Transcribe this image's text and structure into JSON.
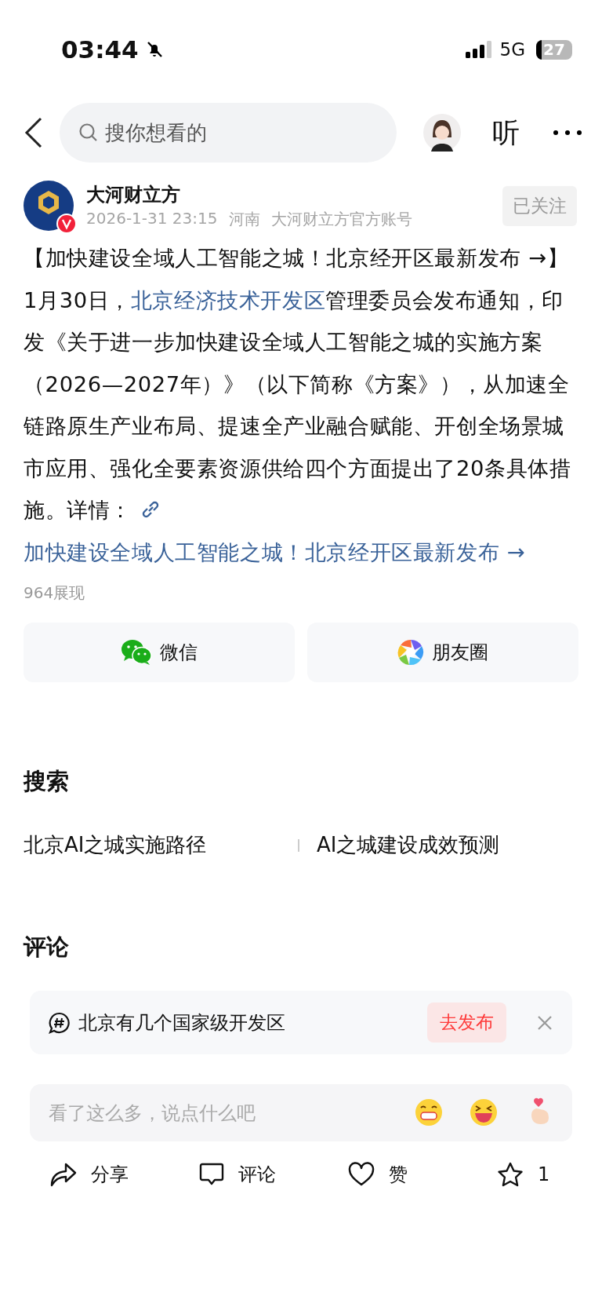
{
  "status_bar": {
    "time": "03:44",
    "silent": true,
    "network": "5G",
    "battery": "27"
  },
  "nav": {
    "search_placeholder": "搜你想看的",
    "listen": "听"
  },
  "author": {
    "name": "大河财立方",
    "verified": true,
    "meta": [
      "2026-1-31 23:15",
      "河南",
      "大河财立方官方账号"
    ],
    "follow_label": "已关注",
    "followed": true
  },
  "post": {
    "segments": [
      {
        "kind": "text",
        "text": "【加快建设全域人工智能之城！北京经开区最新发布 →】1月30日，"
      },
      {
        "kind": "link",
        "text": "北京经济技术开发区"
      },
      {
        "kind": "text",
        "text": "管理委员会发布通知，印发《关于进一步加快建设全域人工智能之城的实施方案（2026—2027年）》（以下简称《方案》），从加速全链路原生产业布局、提速全产业融合赋能、开创全场景城市应用、强化全要素资源供给四个方面提出了20条具体措施。详情："
      }
    ],
    "link_title": "加快建设全域人工智能之城！北京经开区最新发布 →",
    "views": "964展现"
  },
  "share": [
    {
      "kind": "wechat",
      "label": "微信"
    },
    {
      "kind": "moments",
      "label": "朋友圈"
    }
  ],
  "search": {
    "title": "搜索",
    "suggestions": [
      "北京AI之城实施路径",
      "AI之城建设成效预测"
    ]
  },
  "comments": {
    "title": "评论",
    "topic": "北京有几个国家级开发区",
    "topic_action": "去发布",
    "input_placeholder": "看了这么多，说点什么吧"
  },
  "actions": [
    {
      "kind": "share",
      "label": "分享"
    },
    {
      "kind": "comment",
      "label": "评论"
    },
    {
      "kind": "like",
      "label": "赞"
    },
    {
      "kind": "favorite",
      "label": "1"
    }
  ]
}
